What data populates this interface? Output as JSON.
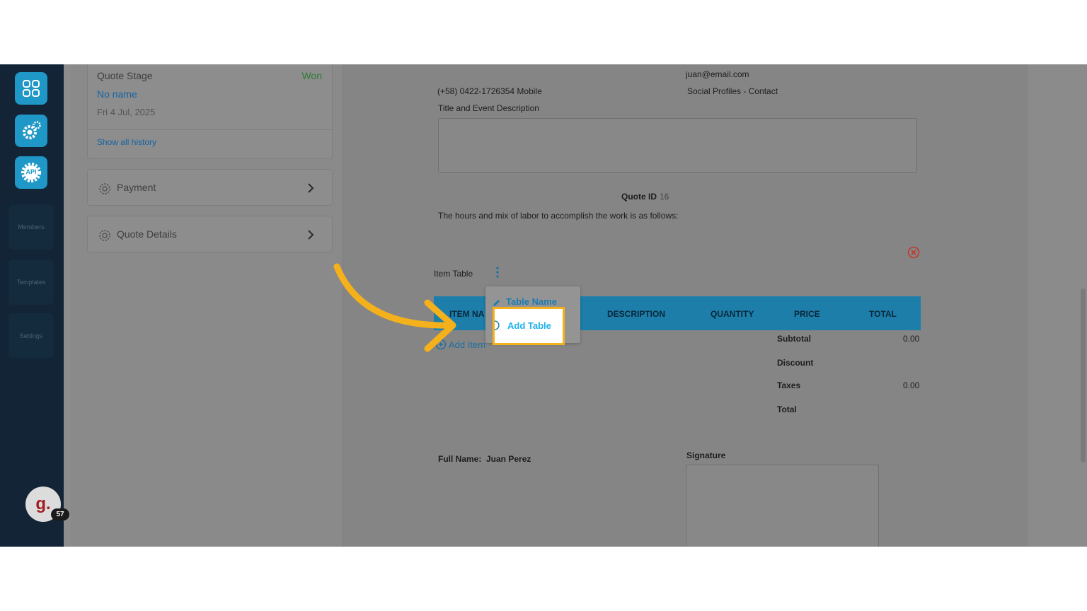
{
  "sidebar": {
    "buttons": [
      {
        "name": "apps-grid-icon"
      },
      {
        "name": "settings-gear-icon"
      },
      {
        "name": "api-icon",
        "label": "API"
      }
    ],
    "nav": [
      "Members",
      "Templates",
      "Settings"
    ],
    "avatar": {
      "initial": "g.",
      "badge": "57"
    }
  },
  "left_panel": {
    "history": {
      "stage_label": "Quote Stage",
      "stage_value": "Won",
      "name": "No name",
      "date": "Fri 4 Jul, 2025",
      "show_history": "Show all history"
    },
    "accordions": [
      {
        "label": "Payment",
        "icon": "gear-icon"
      },
      {
        "label": "Quote Details",
        "icon": "gear-icon"
      }
    ]
  },
  "document": {
    "email": "juan@email.com",
    "phone": "(+58) 0422-1726354 Mobile",
    "social": "Social Profiles - Contact",
    "title_label": "Title and Event Description",
    "quote_id_label": "Quote ID",
    "quote_id_value": "16",
    "hours_text": "The hours and mix of labor to accomplish the work is as follows:",
    "item_table_label": "Item Table",
    "columns": [
      "ITEM NA",
      "DESCRIPTION",
      "QUANTITY",
      "PRICE",
      "TOTAL"
    ],
    "add_item": "Add Item",
    "totals": [
      {
        "label": "Subtotal",
        "value": "0.00"
      },
      {
        "label": "Discount",
        "value": ""
      },
      {
        "label": "Taxes",
        "value": "0.00"
      },
      {
        "label": "Total",
        "value": ""
      }
    ],
    "full_name_label": "Full Name:",
    "full_name_value": "Juan Perez",
    "signature_label": "Signature"
  },
  "dropdown": {
    "table_name": "Table Name",
    "add_table": "Add Table"
  },
  "colors": {
    "accent": "#1f97c7",
    "highlight": "#f5b11b",
    "won": "#2e7d32",
    "sidebar": "#122436"
  }
}
